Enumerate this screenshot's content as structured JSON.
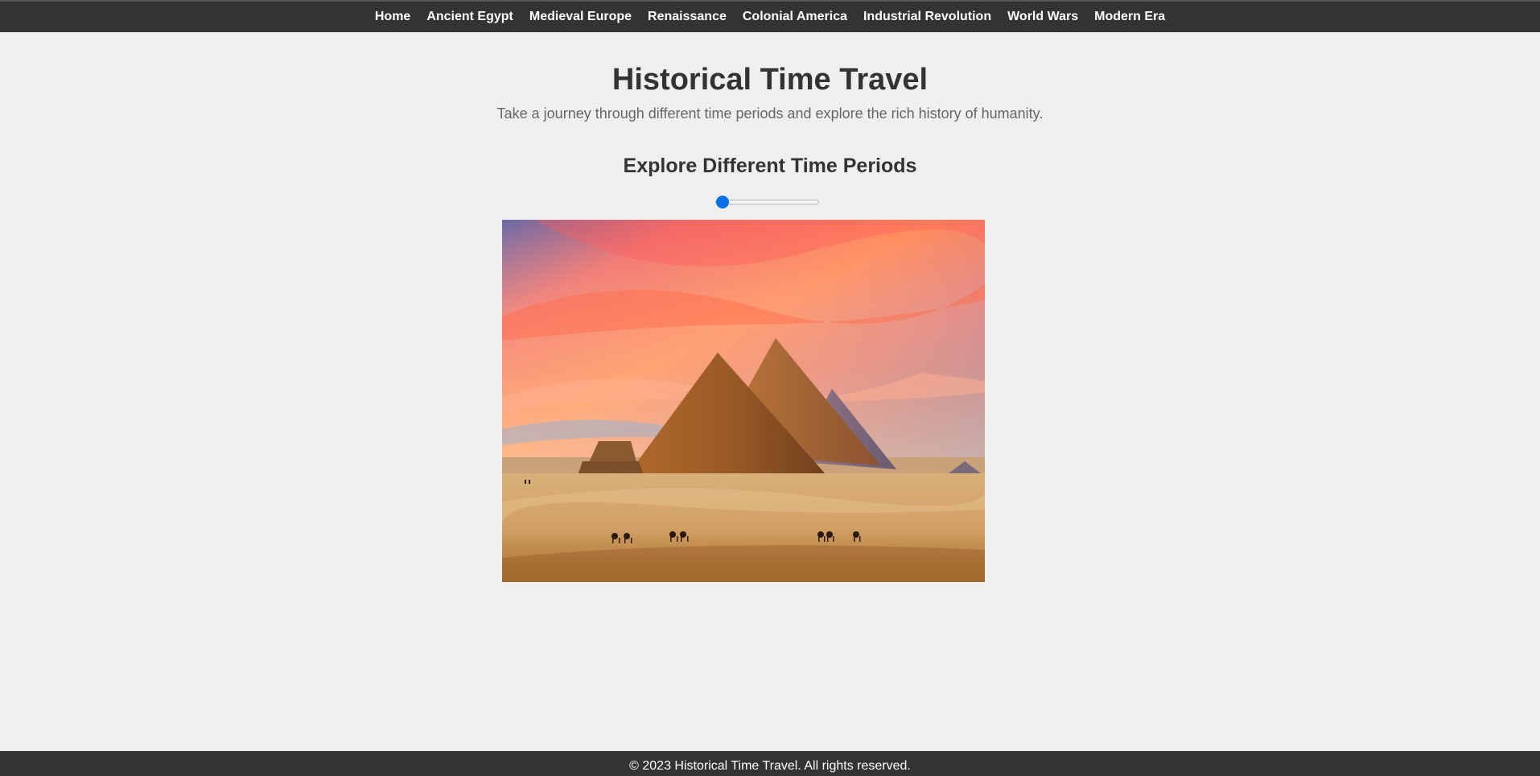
{
  "nav": {
    "items": [
      {
        "label": "Home"
      },
      {
        "label": "Ancient Egypt"
      },
      {
        "label": "Medieval Europe"
      },
      {
        "label": "Renaissance"
      },
      {
        "label": "Colonial America"
      },
      {
        "label": "Industrial Revolution"
      },
      {
        "label": "World Wars"
      },
      {
        "label": "Modern Era"
      }
    ]
  },
  "header": {
    "title": "Historical Time Travel",
    "subtitle": "Take a journey through different time periods and explore the rich history of humanity."
  },
  "explore": {
    "heading": "Explore Different Time Periods",
    "slider": {
      "value": 0,
      "accent_color": "#0a70e8"
    },
    "image": {
      "subject": "pyramids-of-giza"
    }
  },
  "footer": {
    "text": "© 2023 Historical Time Travel. All rights reserved."
  },
  "colors": {
    "nav_background": "#333333",
    "page_background": "#efefef",
    "heading_text": "#333333",
    "subtitle_text": "#666666"
  }
}
